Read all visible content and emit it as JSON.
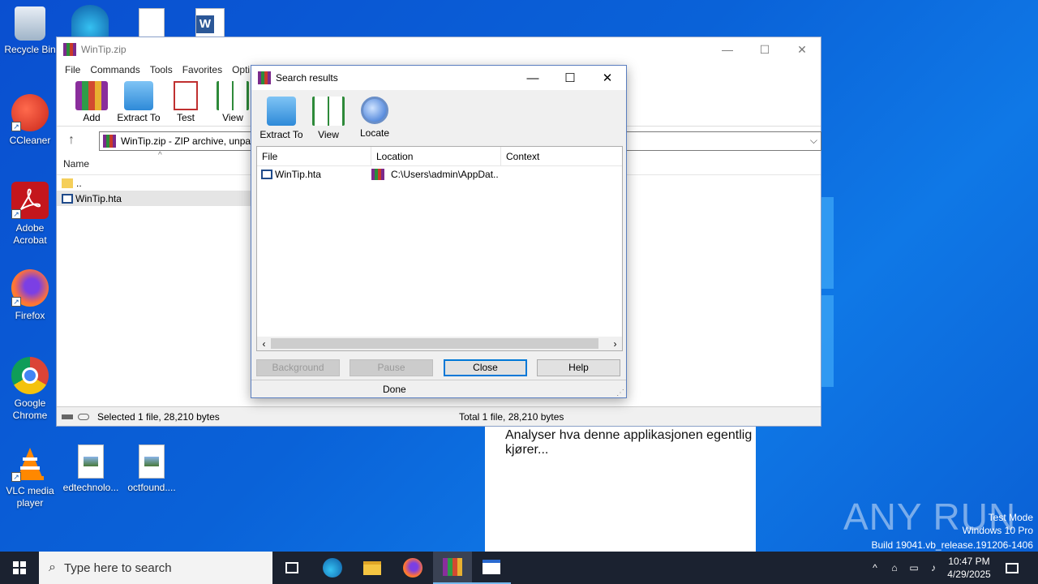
{
  "desktop": {
    "icons": [
      {
        "label": "Recycle Bin"
      },
      {
        "label": "CCleaner"
      },
      {
        "label": "Adobe Acrobat"
      },
      {
        "label": "Firefox"
      },
      {
        "label": "Google Chrome"
      },
      {
        "label": "VLC media player"
      },
      {
        "label": "edtechnolo..."
      },
      {
        "label": "octfound...."
      }
    ]
  },
  "main_window": {
    "title": "WinTip.zip",
    "menu": [
      "File",
      "Commands",
      "Tools",
      "Favorites",
      "Opti"
    ],
    "toolbar": [
      "Add",
      "Extract To",
      "Test",
      "View"
    ],
    "address": "WinTip.zip - ZIP archive, unpac",
    "column_name": "Name",
    "files": [
      "..",
      "WinTip.hta"
    ],
    "status_left": "Selected 1 file, 28,210 bytes",
    "status_right": "Total 1 file, 28,210 bytes"
  },
  "search_dialog": {
    "title": "Search results",
    "toolbar": [
      "Extract To",
      "View",
      "Locate"
    ],
    "columns": [
      "File",
      "Location",
      "Context"
    ],
    "rows": [
      {
        "file": "WinTip.hta",
        "location": "C:\\Users\\admin\\AppDat...",
        "context": ""
      }
    ],
    "buttons": {
      "background": "Background",
      "pause": "Pause",
      "close": "Close",
      "help": "Help"
    },
    "status": "Done"
  },
  "hta_window": {
    "text": "Analyser hva denne applikasjonen egentlig kjører..."
  },
  "watermark": {
    "brand": "ANY RUN",
    "line1": "Test Mode",
    "line2": "Windows 10 Pro",
    "line3": "Build 19041.vb_release.191206-1406"
  },
  "taskbar": {
    "search_placeholder": "Type here to search",
    "time": "10:47 PM",
    "date": "4/29/2025"
  },
  "colors": {
    "desktop": "#0a62d8",
    "taskbar": "#1b2230",
    "accent": "#0078d7"
  }
}
